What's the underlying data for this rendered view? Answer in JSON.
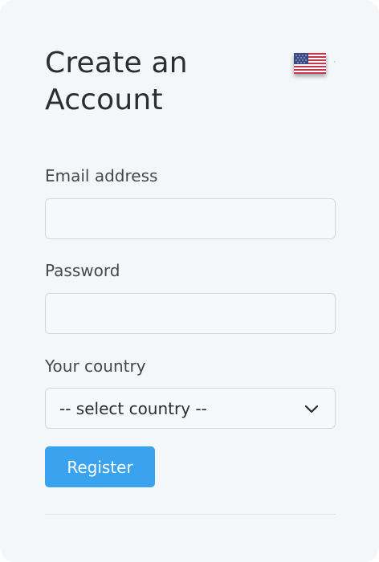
{
  "form": {
    "title_line1": "Create an",
    "title_line2": "Account",
    "language_flag_icon": "us-flag-icon",
    "email": {
      "label": "Email address",
      "value": "",
      "placeholder": ""
    },
    "password": {
      "label": "Password",
      "value": "",
      "placeholder": ""
    },
    "country": {
      "label": "Your country",
      "selected": "-- select country --"
    },
    "register_label": "Register"
  },
  "colors": {
    "card_background": "#f4f7fa",
    "primary_button": "#3aa3ef",
    "text": "#2b2d31",
    "field_border": "#d3d8de"
  }
}
